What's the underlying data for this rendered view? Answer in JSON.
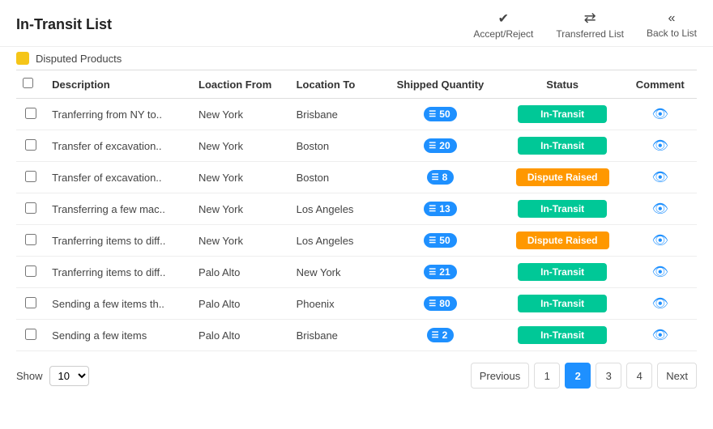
{
  "header": {
    "title": "In-Transit List",
    "actions": [
      {
        "id": "accept-reject",
        "icon": "✅",
        "label": "Accept/Reject"
      },
      {
        "id": "transferred-list",
        "icon": "⇄",
        "label": "Transferred List"
      },
      {
        "id": "back-to-list",
        "icon": "«",
        "label": "Back to List"
      }
    ]
  },
  "disputed": {
    "label": "Disputed Products"
  },
  "table": {
    "columns": [
      "",
      "Description",
      "Loaction From",
      "Location To",
      "Shipped Quantity",
      "Status",
      "Comment"
    ],
    "rows": [
      {
        "id": 1,
        "description": "Tranferring from NY to..",
        "from": "New York",
        "to": "Brisbane",
        "qty": 50,
        "status": "In-Transit",
        "statusType": "intransit"
      },
      {
        "id": 2,
        "description": "Transfer of excavation..",
        "from": "New York",
        "to": "Boston",
        "qty": 20,
        "status": "In-Transit",
        "statusType": "intransit"
      },
      {
        "id": 3,
        "description": "Transfer of excavation..",
        "from": "New York",
        "to": "Boston",
        "qty": 8,
        "status": "Dispute Raised",
        "statusType": "dispute"
      },
      {
        "id": 4,
        "description": "Transferring a few mac..",
        "from": "New York",
        "to": "Los Angeles",
        "qty": 13,
        "status": "In-Transit",
        "statusType": "intransit"
      },
      {
        "id": 5,
        "description": "Tranferring items to diff..",
        "from": "New York",
        "to": "Los Angeles",
        "qty": 50,
        "status": "Dispute Raised",
        "statusType": "dispute"
      },
      {
        "id": 6,
        "description": "Tranferring items to diff..",
        "from": "Palo Alto",
        "to": "New York",
        "qty": 21,
        "status": "In-Transit",
        "statusType": "intransit"
      },
      {
        "id": 7,
        "description": "Sending a few items th..",
        "from": "Palo Alto",
        "to": "Phoenix",
        "qty": 80,
        "status": "In-Transit",
        "statusType": "intransit"
      },
      {
        "id": 8,
        "description": "Sending a few items",
        "from": "Palo Alto",
        "to": "Brisbane",
        "qty": 2,
        "status": "In-Transit",
        "statusType": "intransit"
      }
    ]
  },
  "footer": {
    "show_label": "Show",
    "show_value": "10",
    "pagination": {
      "previous_label": "Previous",
      "next_label": "Next",
      "pages": [
        "1",
        "2",
        "3",
        "4"
      ],
      "active_page": "2"
    }
  }
}
